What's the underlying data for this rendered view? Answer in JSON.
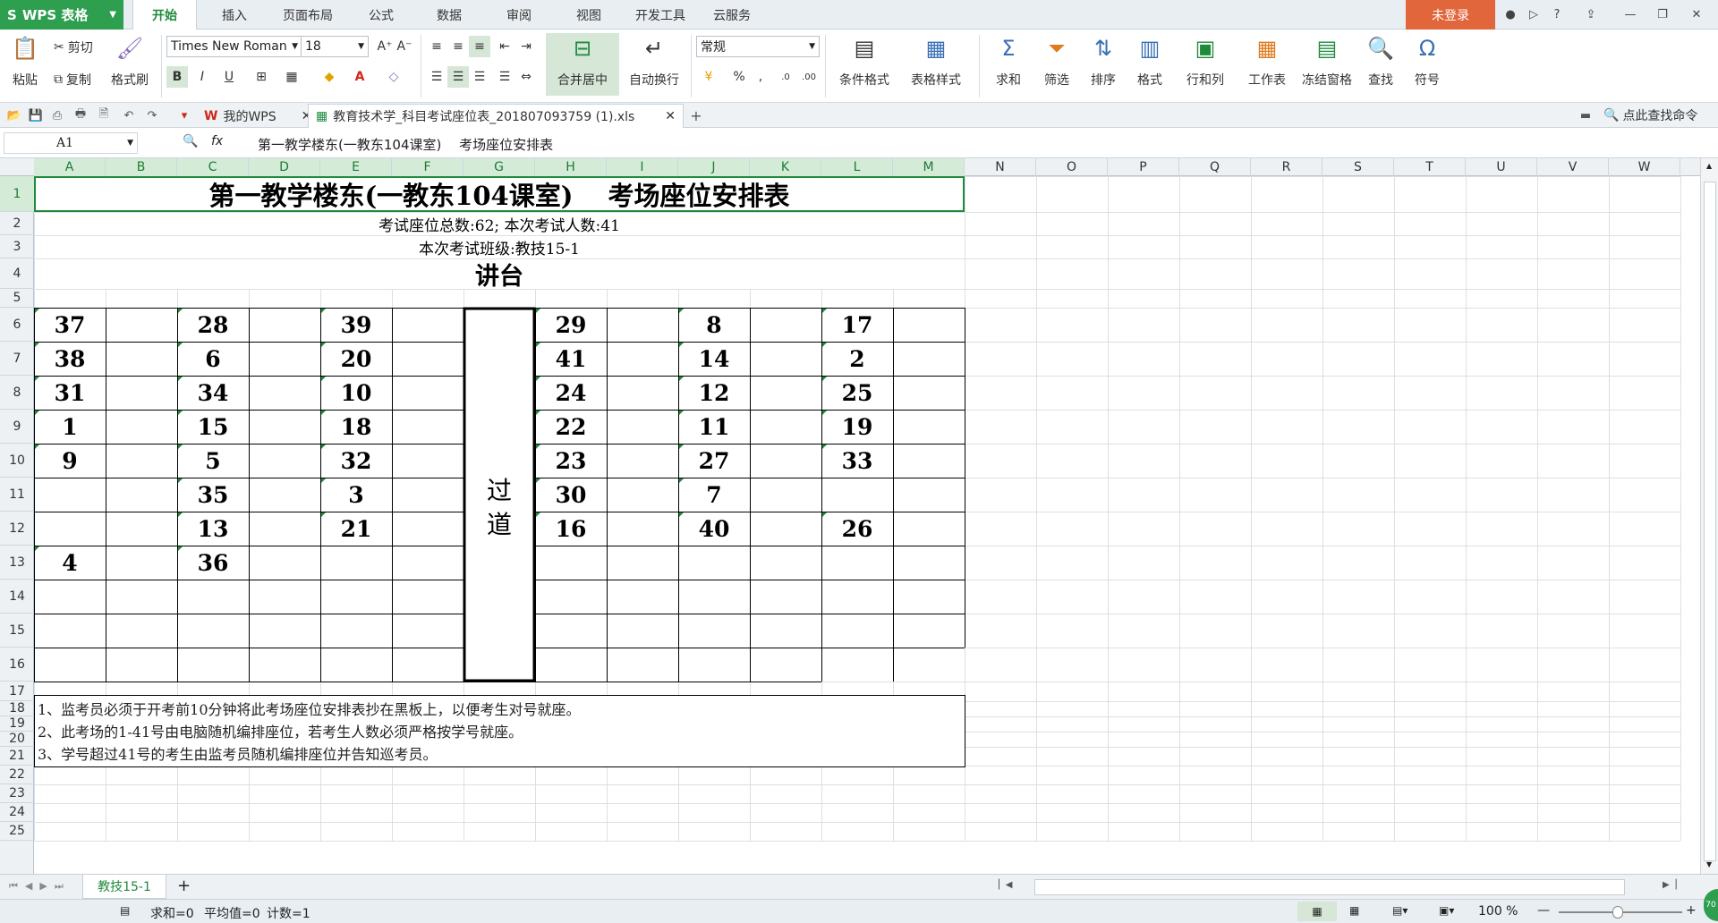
{
  "app": {
    "logo": "WPS 表格",
    "login": "未登录"
  },
  "menu_tabs": [
    "开始",
    "插入",
    "页面布局",
    "公式",
    "数据",
    "审阅",
    "视图",
    "开发工具",
    "云服务"
  ],
  "ribbon": {
    "paste": "粘贴",
    "cut": "剪切",
    "copy": "复制",
    "format_painter": "格式刷",
    "font_name": "Times New Roman",
    "font_size": "18",
    "merge_center": "合并居中",
    "wrap_text": "自动换行",
    "number_format": "常规",
    "cond_format": "条件格式",
    "table_style": "表格样式",
    "sum": "求和",
    "filter": "筛选",
    "sort": "排序",
    "format": "格式",
    "row_col": "行和列",
    "worksheet": "工作表",
    "freeze": "冻结窗格",
    "find": "查找",
    "symbol": "符号"
  },
  "doc_tabs": {
    "my_wps": "我的WPS",
    "file": "教育技术学_科目考试座位表_201807093759 (1).xls",
    "search_cmd": "点此查找命令"
  },
  "formula": {
    "cell_ref": "A1",
    "fx": "fx",
    "content": "第一教学楼东(一教东104课室)　 考场座位安排表"
  },
  "columns": [
    "A",
    "B",
    "C",
    "D",
    "E",
    "F",
    "G",
    "H",
    "I",
    "J",
    "K",
    "L",
    "M",
    "N",
    "O",
    "P",
    "Q",
    "R",
    "S",
    "T",
    "U",
    "V",
    "W"
  ],
  "rows": [
    "1",
    "2",
    "3",
    "4",
    "5",
    "6",
    "7",
    "8",
    "9",
    "10",
    "11",
    "12",
    "13",
    "14",
    "15",
    "16",
    "17",
    "18",
    "19",
    "20",
    "21",
    "22",
    "23",
    "24",
    "25"
  ],
  "sheet": {
    "title": "第一教学楼东(一教东104课室)　 考场座位安排表",
    "info1": "考试座位总数:62;  本次考试人数:41",
    "info2": "本次考试班级:教技15-1",
    "podium": "讲台",
    "aisle_1": "过",
    "aisle_2": "道",
    "seats": {
      "A": [
        "37",
        "38",
        "31",
        "1",
        "9",
        "",
        "",
        "4"
      ],
      "C": [
        "28",
        "6",
        "34",
        "15",
        "5",
        "35",
        "13",
        "36"
      ],
      "E": [
        "39",
        "20",
        "10",
        "18",
        "32",
        "3",
        "21",
        ""
      ],
      "H": [
        "29",
        "41",
        "24",
        "22",
        "23",
        "30",
        "16",
        ""
      ],
      "J": [
        "8",
        "14",
        "12",
        "11",
        "27",
        "7",
        "40",
        ""
      ],
      "L": [
        "17",
        "2",
        "25",
        "19",
        "33",
        "",
        "26",
        ""
      ]
    },
    "notes": [
      "1、监考员必须于开考前10分钟将此考场座位安排表抄在黑板上，以便考生对号就座。",
      "2、此考场的1-41号由电脑随机编排座位，若考生人数必须严格按学号就座。",
      "3、学号超过41号的考生由监考员随机编排座位并告知巡考员。"
    ]
  },
  "sheet_tab": "教技15-1",
  "status": {
    "sum": "求和=0",
    "avg": "平均值=0",
    "count": "计数=1",
    "zoom": "100 %",
    "badge": "70"
  }
}
